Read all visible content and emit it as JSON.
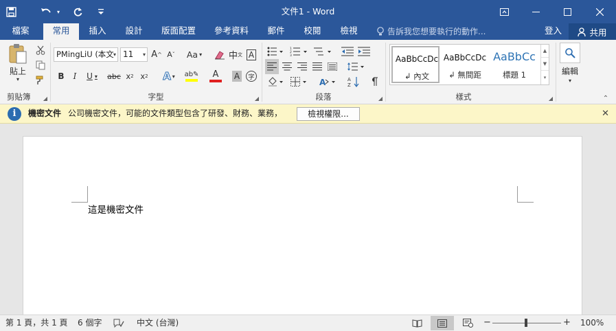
{
  "titlebar": {
    "title": "文件1 - Word",
    "save_icon": "save-icon",
    "undo_icon": "undo-icon",
    "redo_icon": "redo-icon",
    "customize_icon": "customize-qat-icon",
    "ribbon_display_icon": "ribbon-display-options-icon",
    "minimize_icon": "minimize-icon",
    "maximize_icon": "maximize-icon",
    "close_icon": "close-icon",
    "bg_color": "#2b579a"
  },
  "tabs": {
    "file": "檔案",
    "home": "常用",
    "insert": "插入",
    "design": "設計",
    "layout": "版面配置",
    "references": "參考資料",
    "mailings": "郵件",
    "review": "校閱",
    "view": "檢視",
    "tell_me": "告訴我您想要執行的動作...",
    "sign_in": "登入",
    "share": "共用"
  },
  "ribbon": {
    "clipboard": {
      "label": "剪貼簿",
      "paste": "貼上"
    },
    "font": {
      "label": "字型",
      "font_name": "PMingLiU (本文",
      "font_size": "11",
      "change_case": "Aa"
    },
    "paragraph": {
      "label": "段落"
    },
    "styles": {
      "label": "樣式",
      "items": [
        {
          "sample": "AaBbCcDc",
          "name": "↲ 內文"
        },
        {
          "sample": "AaBbCcDc",
          "name": "↲ 無間距"
        },
        {
          "sample": "AaBbCc",
          "name": "標題 1"
        }
      ]
    },
    "editing": {
      "label": "編輯"
    }
  },
  "infobar": {
    "title": "機密文件",
    "message": "公司機密文件，可能的文件類型包含了研發、財務、業務，",
    "button": "檢視權限...",
    "bg_color": "#fcf6c8"
  },
  "document": {
    "text": "這是機密文件"
  },
  "statusbar": {
    "page": "第 1 頁，共 1 頁",
    "words": "6 個字",
    "language": "中文 (台灣)",
    "zoom": "100%",
    "zoom_minus": "−",
    "zoom_plus": "+"
  }
}
